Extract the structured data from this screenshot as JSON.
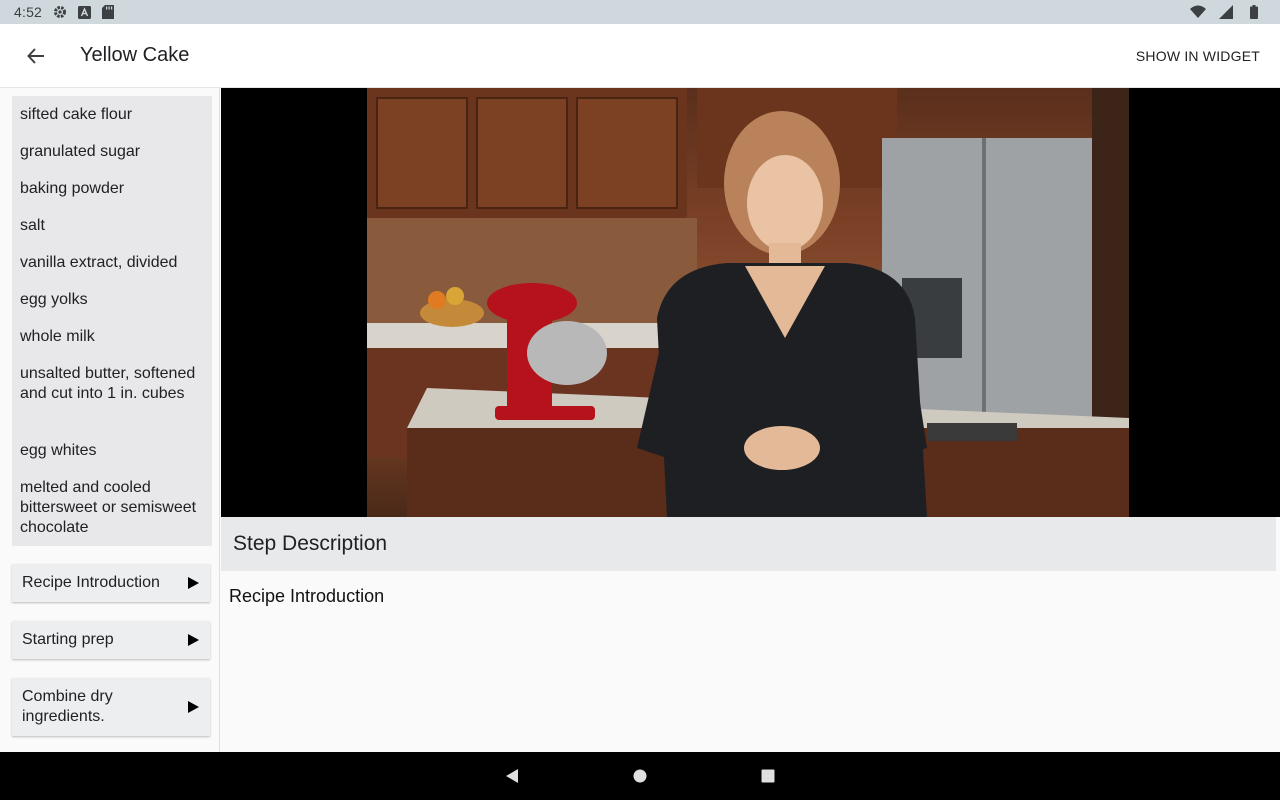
{
  "status": {
    "time": "4:52",
    "icons": [
      "gear-icon",
      "a-icon",
      "sd-card-icon",
      "wifi-icon",
      "signal-icon",
      "battery-icon"
    ]
  },
  "app_bar": {
    "title": "Yellow Cake",
    "action_label": "SHOW IN WIDGET",
    "back_icon": "arrow-back-icon"
  },
  "ingredients": [
    "sifted cake flour",
    "granulated sugar",
    "baking powder",
    "salt",
    "vanilla extract, divided",
    "egg yolks",
    "whole milk",
    "unsalted butter, softened and cut into 1 in. cubes",
    "egg whites",
    "melted and cooled bittersweet or semisweet chocolate"
  ],
  "steps": [
    "Recipe Introduction",
    "Starting prep",
    "Combine dry ingredients."
  ],
  "description": {
    "header": "Step Description",
    "text": "Recipe Introduction"
  },
  "colors": {
    "status_bar": "#cfd8dc",
    "app_bar": "#ffffff",
    "ingredients_bg": "#e8e8ea",
    "nav_bar": "#000000"
  }
}
